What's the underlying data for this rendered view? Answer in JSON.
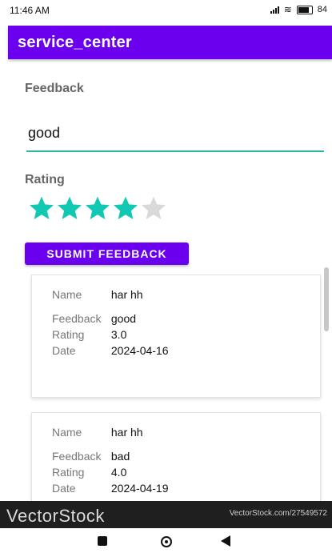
{
  "status_bar": {
    "time": "11:46 AM",
    "battery": "84"
  },
  "app": {
    "title": "service_center"
  },
  "form": {
    "feedback_label": "Feedback",
    "feedback_value": "good",
    "rating_label": "Rating",
    "rating_value": 4,
    "rating_max": 5,
    "submit_label": "SUBMIT FEEDBACK"
  },
  "cards": [
    {
      "name_label": "Name",
      "name_value": "har hh",
      "feedback_label": "Feedback",
      "feedback_value": "good",
      "rating_label": "Rating",
      "rating_value": "3.0",
      "date_label": "Date",
      "date_value": "2024-04-16"
    },
    {
      "name_label": "Name",
      "name_value": "har hh",
      "feedback_label": "Feedback",
      "feedback_value": "bad",
      "rating_label": "Rating",
      "rating_value": "4.0",
      "date_label": "Date",
      "date_value": "2024-04-19"
    }
  ],
  "watermark": {
    "left": "VectorStock",
    "right": "VectorStock.com/27549572"
  },
  "colors": {
    "primary": "#6a00ee",
    "accent": "#2bb7a3",
    "star_filled": "#11c9b2",
    "star_empty": "#d9d9d9"
  },
  "icons": {
    "star": "star-icon",
    "nav_recents": "square-icon",
    "nav_home": "circle-icon",
    "nav_back": "triangle-back-icon"
  }
}
